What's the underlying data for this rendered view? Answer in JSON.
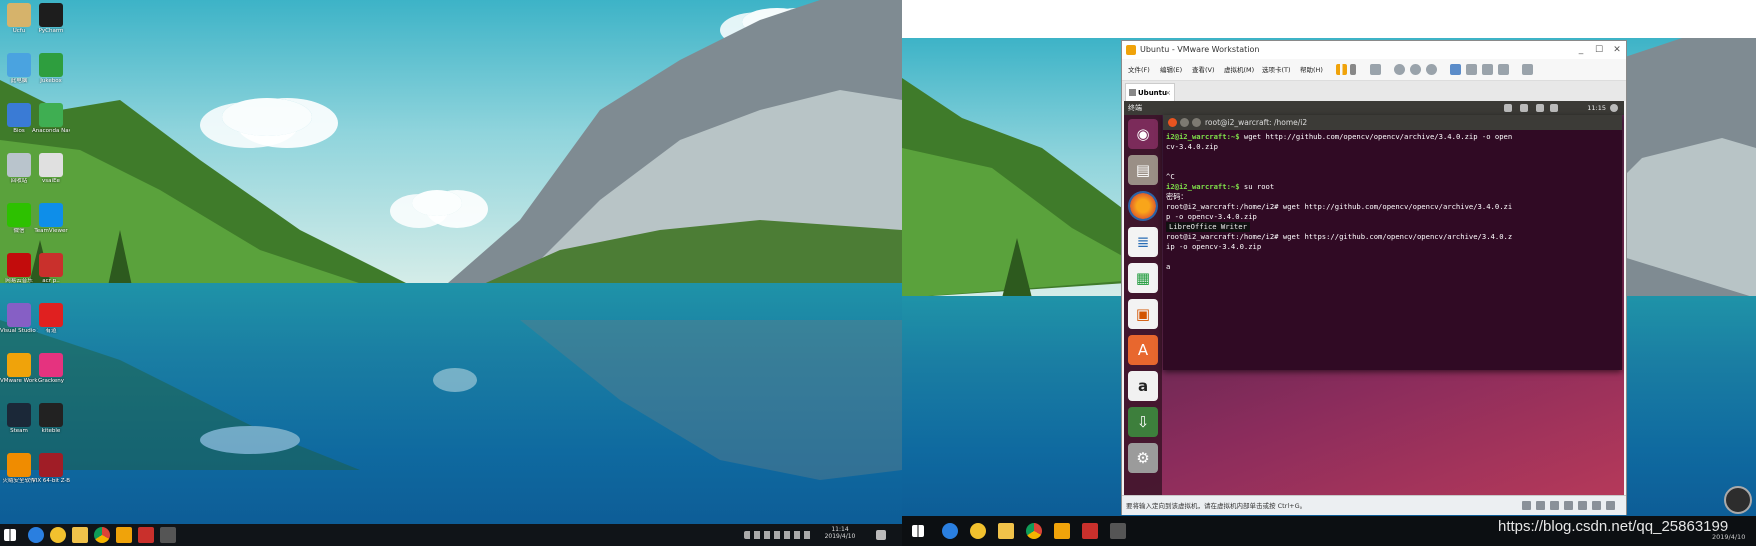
{
  "left_desktop": {
    "icons": [
      {
        "label": "Ucfu",
        "color": "#d6b36b"
      },
      {
        "label": "PyCharm",
        "color": "#1d1d1d"
      },
      {
        "label": "此电脑",
        "color": "#4aa3e0"
      },
      {
        "label": "Jukebox",
        "color": "#2e9e3e"
      },
      {
        "label": "Bios",
        "color": "#3a7bd5"
      },
      {
        "label": "Anaconda Navigator",
        "color": "#3fae52"
      },
      {
        "label": "回收站",
        "color": "#b9c4cc"
      },
      {
        "label": "vsaiEe",
        "color": "#e0e0e0"
      },
      {
        "label": "微信",
        "color": "#2dc100"
      },
      {
        "label": "TeamViewer",
        "color": "#0e8ee9"
      },
      {
        "label": "网易云音乐",
        "color": "#c20c0c"
      },
      {
        "label": "acr p..",
        "color": "#c9302c"
      },
      {
        "label": "Visual Studio 2017",
        "color": "#865fc5"
      },
      {
        "label": "有道",
        "color": "#e02020"
      },
      {
        "label": "VMware Workstation",
        "color": "#f0a30a"
      },
      {
        "label": "Grackeny",
        "color": "#e5337f"
      },
      {
        "label": "Steam",
        "color": "#1b2838"
      },
      {
        "label": "kiteble",
        "color": "#222222"
      },
      {
        "label": "火绒安全软件",
        "color": "#f08c00"
      },
      {
        "label": "VIX 64-bit Z-Band",
        "color": "#a01d26"
      }
    ],
    "taskbar": {
      "clock_time": "11:14",
      "clock_date": "2019/4/10"
    }
  },
  "vmware": {
    "title": "Ubuntu - VMware Workstation",
    "menu": [
      "文件(F)",
      "编辑(E)",
      "查看(V)",
      "虚拟机(M)",
      "选项卡(T)",
      "帮助(H)"
    ],
    "tab_label": "Ubuntu",
    "status_text": "要将输入定向到该虚拟机，请在虚拟机内部单击或按 Ctrl+G。"
  },
  "ubuntu": {
    "topbar_label": "终端",
    "clock": "11:15",
    "tooltip": "LibreOffice Writer",
    "terminal": {
      "title": "root@i2_warcraft: /home/i2",
      "lines": [
        {
          "prompt": "i2@i2_warcraft:~$",
          "text": " wget http://github.com/opencv/opencv/archive/3.4.0.zip -o open"
        },
        {
          "prompt": "",
          "text": "cv-3.4.0.zip"
        },
        {
          "prompt": "",
          "text": ""
        },
        {
          "prompt": "",
          "text": ""
        },
        {
          "prompt": "",
          "text": "^C"
        },
        {
          "prompt": "i2@i2_warcraft:~$",
          "text": " su root"
        },
        {
          "prompt": "",
          "text": "密码："
        },
        {
          "prompt": "",
          "text": "root@i2_warcraft:/home/i2# wget http://github.com/opencv/opencv/archive/3.4.0.zi"
        },
        {
          "prompt": "",
          "text": "p -o opencv-3.4.0.zip"
        },
        {
          "prompt": "",
          "text": "root@i2_warcraft:/home/i2# wget https://github.com/opencv/opencv/archive/3.4.0.z"
        },
        {
          "prompt": "",
          "text": "ip -o opencv-3.4.0.zip"
        },
        {
          "prompt": "",
          "text": ""
        },
        {
          "prompt": "",
          "text": "a"
        }
      ]
    }
  },
  "right_desktop": {
    "date": "2019/4/10"
  },
  "watermark": "https://blog.csdn.net/qq_25863199"
}
